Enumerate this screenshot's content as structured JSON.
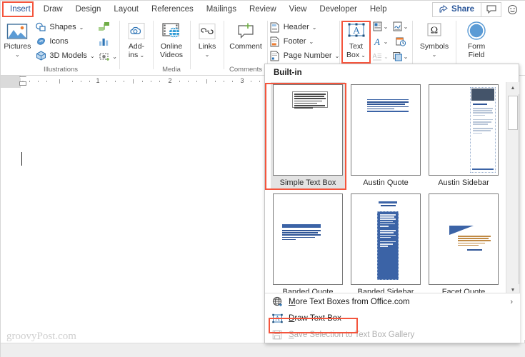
{
  "tabs": [
    {
      "label": "Insert",
      "active": true
    },
    {
      "label": "Draw",
      "active": false
    },
    {
      "label": "Design",
      "active": false
    },
    {
      "label": "Layout",
      "active": false
    },
    {
      "label": "References",
      "active": false
    },
    {
      "label": "Mailings",
      "active": false
    },
    {
      "label": "Review",
      "active": false
    },
    {
      "label": "View",
      "active": false
    },
    {
      "label": "Developer",
      "active": false
    },
    {
      "label": "Help",
      "active": false
    }
  ],
  "topright": {
    "share_label": "Share",
    "comment_icon": "comment-icon",
    "emoji_icon": "smiley-feedback-icon"
  },
  "ribbon": {
    "groups": [
      {
        "name": "Illustrations",
        "label": "Illustrations",
        "big": {
          "label_line1": "Pictures",
          "icon": "picture-icon",
          "has_caret": true
        },
        "small": [
          {
            "label": "Shapes",
            "icon": "shapes-icon",
            "caret": true
          },
          {
            "label": "Icons",
            "icon": "icons-icon",
            "caret": false
          },
          {
            "label": "3D Models",
            "icon": "3d-model-icon",
            "caret": true
          }
        ],
        "icons_col": [
          {
            "icon": "smartart-icon",
            "caret": false
          },
          {
            "icon": "chart-icon",
            "caret": false
          },
          {
            "icon": "screenshot-icon",
            "caret": true
          }
        ]
      },
      {
        "name": "AddIns",
        "label": "",
        "big": {
          "label_line1": "Add-",
          "label_line2": "ins",
          "icon": "add-ins-icon",
          "has_caret": true
        }
      },
      {
        "name": "Media",
        "label": "Media",
        "big": {
          "label_line1": "Online",
          "label_line2": "Videos",
          "icon": "online-video-icon",
          "has_caret": false
        }
      },
      {
        "name": "Links",
        "label": "",
        "big": {
          "label_line1": "Links",
          "icon": "links-icon",
          "has_caret": true
        }
      },
      {
        "name": "Comments",
        "label": "Comments",
        "big": {
          "label_line1": "Comment",
          "icon": "new-comment-icon",
          "has_caret": false
        }
      },
      {
        "name": "HeaderFooter",
        "label": "",
        "small": [
          {
            "label": "Header",
            "icon": "header-icon",
            "caret": true
          },
          {
            "label": "Footer",
            "icon": "footer-icon",
            "caret": true
          },
          {
            "label": "Page Number",
            "icon": "page-number-icon",
            "caret": true
          }
        ]
      },
      {
        "name": "Text",
        "label": "",
        "big": {
          "label_line1": "Text",
          "label_line2": "Box",
          "icon": "text-box-icon",
          "has_caret": true,
          "highlighted": true
        },
        "icons_col1": [
          {
            "icon": "quick-parts-icon",
            "caret": true
          },
          {
            "icon": "wordart-icon",
            "caret": true
          },
          {
            "icon": "drop-cap-icon",
            "caret": true,
            "disabled": true
          }
        ],
        "icons_col2": [
          {
            "icon": "signature-line-icon",
            "caret": true
          },
          {
            "icon": "date-time-icon",
            "caret": false
          },
          {
            "icon": "insert-object-icon",
            "caret": true
          }
        ]
      },
      {
        "name": "Symbols",
        "label": "",
        "big": {
          "label_line1": "Symbols",
          "icon": "omega-symbol-icon",
          "has_caret": true
        }
      },
      {
        "name": "FormField",
        "label": "",
        "big": {
          "label_line1": "Form",
          "label_line2": "Field",
          "icon": "form-field-icon",
          "has_caret": false
        }
      }
    ]
  },
  "ruler": {
    "numbers": [
      "1",
      "2",
      "3"
    ],
    "indent_marker": "indent-marker"
  },
  "document": {
    "cursor": "text-caret",
    "watermark": "groovyPost.com"
  },
  "dropdown": {
    "header": "Built-in",
    "gallery": [
      [
        {
          "name": "Simple Text Box",
          "style": "simple",
          "selected": true
        },
        {
          "name": "Austin Quote",
          "style": "austin-quote",
          "selected": false
        },
        {
          "name": "Austin Sidebar",
          "style": "austin-sidebar",
          "selected": false
        }
      ],
      [
        {
          "name": "Banded Quote",
          "style": "banded-quote",
          "selected": false
        },
        {
          "name": "Banded Sidebar",
          "style": "banded-sidebar",
          "selected": false
        },
        {
          "name": "Facet Quote",
          "style": "facet-quote",
          "selected": false
        }
      ]
    ],
    "menu": [
      {
        "label": "More Text Boxes from Office.com",
        "icon": "globe-icon",
        "disabled": false,
        "submenu": true,
        "accel": "M",
        "highlighted": false
      },
      {
        "label": "Draw Text Box",
        "icon": "draw-text-box-icon",
        "disabled": false,
        "submenu": false,
        "accel": "D",
        "highlighted": true
      },
      {
        "label": "Save Selection to Text Box Gallery",
        "icon": "save-icon",
        "disabled": true,
        "submenu": false,
        "accel": "S",
        "highlighted": false
      }
    ],
    "scrollbar": {
      "up": "scroll-up-arrow",
      "down": "scroll-down-arrow"
    }
  },
  "colors": {
    "accent": "#2b579a",
    "highlight": "#f4553d",
    "ribbon_bg": "#ffffff",
    "thumb_blue": "#3b63a6"
  }
}
